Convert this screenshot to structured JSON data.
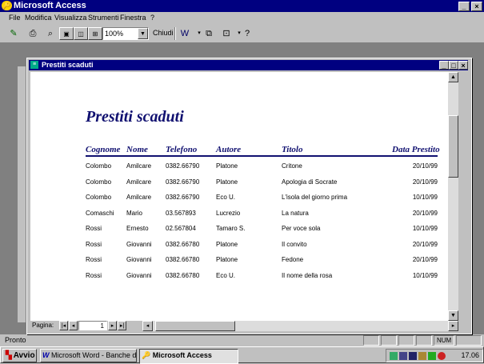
{
  "app": {
    "title": "Microsoft Access",
    "window_buttons": [
      "_",
      "▫",
      "×"
    ]
  },
  "menu": [
    {
      "label": "File"
    },
    {
      "label": "Modifica"
    },
    {
      "label": "Visualizza"
    },
    {
      "label": "Strumenti"
    },
    {
      "label": "Finestra"
    },
    {
      "label": "?"
    }
  ],
  "toolbar": {
    "zoom_value": "100%",
    "close_label": "Chiudi"
  },
  "report_window": {
    "title": "Prestiti scaduti",
    "nav_label": "Pagina:",
    "page_number": "1"
  },
  "report": {
    "title": "Prestiti scaduti",
    "columns": [
      "Cognome",
      "Nome",
      "Telefono",
      "Autore",
      "Titolo",
      "Data Prestito"
    ],
    "rows": [
      [
        "Colombo",
        "Amilcare",
        "0382.66790",
        "Platone",
        "Critone",
        "20/10/99"
      ],
      [
        "Colombo",
        "Amilcare",
        "0382.66790",
        "Platone",
        "Apologia di Socrate",
        "20/10/99"
      ],
      [
        "Colombo",
        "Amilcare",
        "0382.66790",
        "Eco U.",
        "L'isola del giorno prima",
        "10/10/99"
      ],
      [
        "Comaschi",
        "Mario",
        "03.567893",
        "Lucrezio",
        "La natura",
        "20/10/99"
      ],
      [
        "Rossi",
        "Ernesto",
        "02.567804",
        "Tamaro S.",
        "Per voce sola",
        "10/10/99"
      ],
      [
        "Rossi",
        "Giovanni",
        "0382.66780",
        "Platone",
        "Il convito",
        "20/10/99"
      ],
      [
        "Rossi",
        "Giovanni",
        "0382.66780",
        "Platone",
        "Fedone",
        "20/10/99"
      ],
      [
        "Rossi",
        "Giovanni",
        "0382.66780",
        "Eco U.",
        "Il nome della rosa",
        "10/10/99"
      ]
    ]
  },
  "status": {
    "text": "Pronto",
    "num_indicator": "NUM"
  },
  "taskbar": {
    "start_label": "Avvio",
    "tasks": [
      {
        "label": "Microsoft Word - Banche d..."
      },
      {
        "label": "Microsoft Access"
      }
    ],
    "clock": "17.06"
  }
}
